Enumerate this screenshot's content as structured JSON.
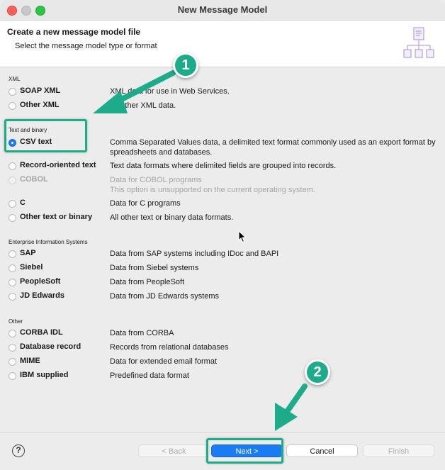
{
  "window": {
    "title": "New Message Model"
  },
  "header": {
    "title": "Create a new message model file",
    "subtitle": "Select the message model type or format"
  },
  "groups": {
    "xml": {
      "title": "XML",
      "options": [
        {
          "label": "SOAP XML",
          "description": "XML data for use in Web Services."
        },
        {
          "label": "Other XML",
          "description": "All other XML data."
        }
      ]
    },
    "text_binary": {
      "title": "Text and binary",
      "options": [
        {
          "label": "CSV text",
          "description": "Comma Separated Values data, a delimited text format commonly used as an export format by spreadsheets and databases.",
          "selected": true
        },
        {
          "label": "Record-oriented text",
          "description": "Text data formats where delimited fields are grouped into records."
        },
        {
          "label": "COBOL",
          "description": "Data for COBOL programs",
          "description2": "This option is unsupported on the current operating system.",
          "disabled": true
        },
        {
          "label": "C",
          "description": "Data for C programs"
        },
        {
          "label": "Other text or binary",
          "description": "All other text or binary data formats."
        }
      ]
    },
    "eis": {
      "title": "Enterprise Information Systems",
      "options": [
        {
          "label": "SAP",
          "description": "Data from SAP systems including IDoc and BAPI"
        },
        {
          "label": "Siebel",
          "description": "Data from Siebel systems"
        },
        {
          "label": "PeopleSoft",
          "description": "Data from PeopleSoft"
        },
        {
          "label": "JD Edwards",
          "description": "Data from JD Edwards systems"
        }
      ]
    },
    "other": {
      "title": "Other",
      "options": [
        {
          "label": "CORBA IDL",
          "description": "Data from CORBA"
        },
        {
          "label": "Database record",
          "description": "Records from relational databases"
        },
        {
          "label": "MIME",
          "description": "Data for extended email format"
        },
        {
          "label": "IBM supplied",
          "description": "Predefined data format"
        }
      ]
    }
  },
  "footer": {
    "help": "?",
    "back_label": "< Back",
    "next_label": "Next >",
    "cancel_label": "Cancel",
    "finish_label": "Finish"
  },
  "annotations": {
    "badge1": "1",
    "badge2": "2",
    "color": "#1cac8a"
  },
  "colors": {
    "accent": "#1a7cf3",
    "highlight": "#1cac8a"
  }
}
